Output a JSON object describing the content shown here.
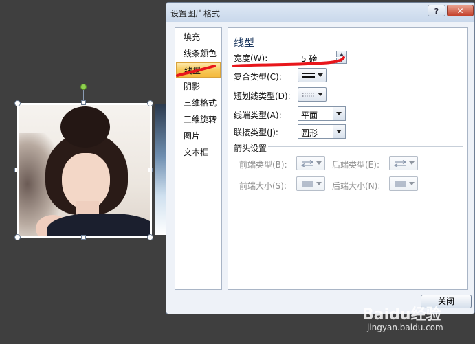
{
  "dialog": {
    "title": "设置图片格式",
    "help_label": "?",
    "close_x_label": "✕",
    "close_button_label": "关闭"
  },
  "categories": [
    {
      "label": "填充",
      "selected": false
    },
    {
      "label": "线条颜色",
      "selected": false
    },
    {
      "label": "线型",
      "selected": true
    },
    {
      "label": "阴影",
      "selected": false
    },
    {
      "label": "三维格式",
      "selected": false
    },
    {
      "label": "三维旋转",
      "selected": false
    },
    {
      "label": "图片",
      "selected": false
    },
    {
      "label": "文本框",
      "selected": false
    }
  ],
  "line_style": {
    "section_title": "线型",
    "width_label": "宽度(W):",
    "width_value": "5 磅",
    "compound_label": "复合类型(C):",
    "dash_label": "短划线类型(D):",
    "cap_label": "线端类型(A):",
    "cap_value": "平面",
    "join_label": "联接类型(J):",
    "join_value": "圆形"
  },
  "arrows": {
    "group_title": "箭头设置",
    "begin_type_label": "前端类型(B):",
    "end_type_label": "后端类型(E):",
    "begin_size_label": "前端大小(S):",
    "end_size_label": "后端大小(N):"
  },
  "watermark": {
    "brand": "Baidu经验",
    "url": "jingyan.baidu.com"
  },
  "colors": {
    "annotation_red": "#e8161b",
    "selection_gold": "#f7c95b"
  }
}
